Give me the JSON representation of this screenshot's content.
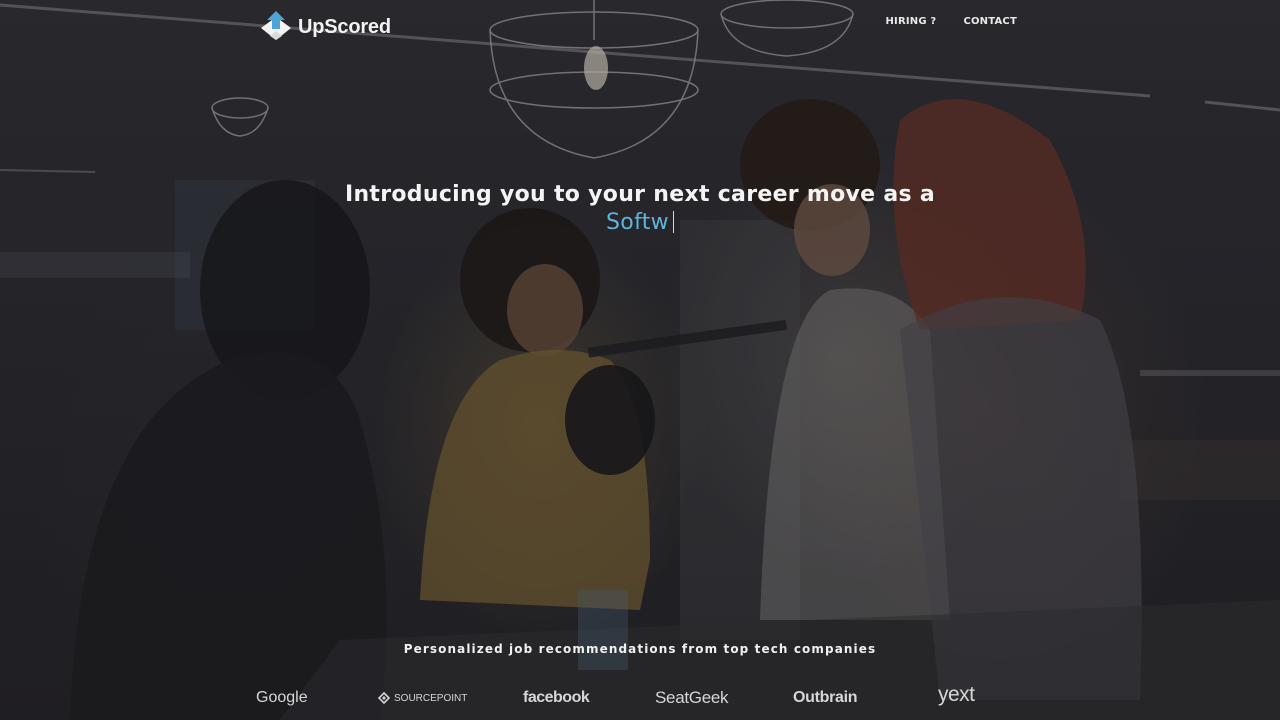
{
  "brand": {
    "name": "UpScored",
    "logo_icon": "upscored-logo-icon",
    "accent_color": "#5fb4dc"
  },
  "nav": {
    "items": [
      {
        "label": "HIRING ?"
      },
      {
        "label": "CONTACT"
      }
    ]
  },
  "hero": {
    "headline": "Introducing you to your next career move as a",
    "typed_text": "Softw",
    "tagline": "Personalized job recommendations from top tech companies"
  },
  "partners": [
    {
      "name": "Google"
    },
    {
      "name": "SOURCEPOINT"
    },
    {
      "name": "facebook"
    },
    {
      "name": "SeatGeek"
    },
    {
      "name": "Outbrain"
    },
    {
      "name": "yext"
    }
  ]
}
